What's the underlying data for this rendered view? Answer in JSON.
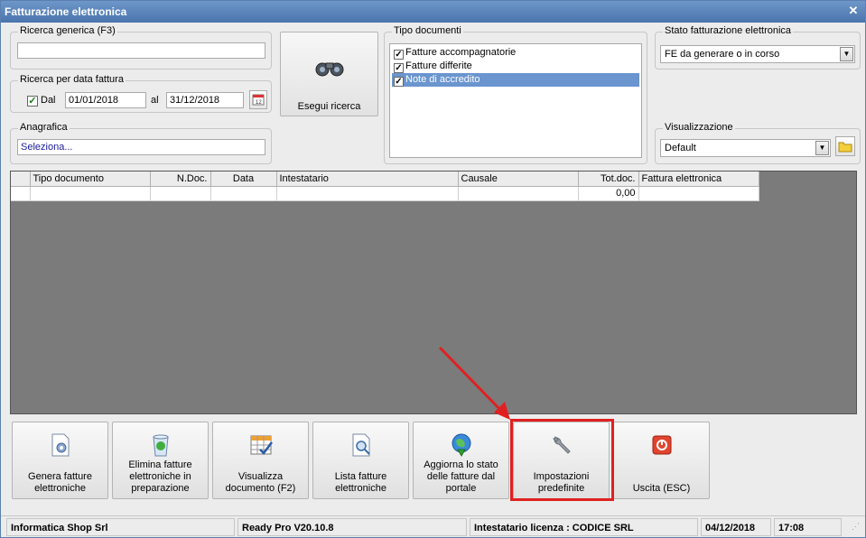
{
  "window": {
    "title": "Fatturazione elettronica"
  },
  "ricerca_generica": {
    "label": "Ricerca generica (F3)",
    "value": ""
  },
  "ricerca_data": {
    "label": "Ricerca per data fattura",
    "dal_label": "Dal",
    "dal_checked": true,
    "dal_value": "01/01/2018",
    "al_label": "al",
    "al_value": "31/12/2018"
  },
  "anagrafica": {
    "label": "Anagrafica",
    "value": "Seleziona..."
  },
  "search_button": {
    "label": "Esegui ricerca"
  },
  "tipo_documenti": {
    "label": "Tipo documenti",
    "items": [
      {
        "label": "Fatture accompagnatorie",
        "checked": true
      },
      {
        "label": "Fatture differite",
        "checked": true
      },
      {
        "label": "Note di accredito",
        "checked": true
      }
    ]
  },
  "stato": {
    "label": "Stato fatturazione elettronica",
    "value": "FE da generare o in corso"
  },
  "visualizzazione": {
    "label": "Visualizzazione",
    "value": "Default"
  },
  "grid": {
    "columns": [
      "Tipo documento",
      "N.Doc.",
      "Data",
      "Intestatario",
      "Causale",
      "Tot.doc.",
      "Fattura elettronica"
    ],
    "row": {
      "tot": "0,00"
    }
  },
  "buttons": {
    "genera": "Genera fatture elettroniche",
    "elimina": "Elimina fatture elettroniche in preparazione",
    "visualizza": "Visualizza documento (F2)",
    "lista": "Lista fatture elettroniche",
    "aggiorna": "Aggiorna lo stato delle fatture dal portale",
    "impostazioni": "Impostazioni predefinite",
    "uscita": "Uscita (ESC)"
  },
  "status": {
    "company": "Informatica Shop Srl",
    "version": "Ready Pro V20.10.8",
    "licenza": "Intestatario licenza : CODICE SRL",
    "date": "04/12/2018",
    "time": "17:08"
  },
  "colors": {
    "titlebar": "#4a74ad",
    "grid_bg": "#7b7b7b",
    "highlight": "#e02020",
    "selection": "#6a95cf"
  }
}
